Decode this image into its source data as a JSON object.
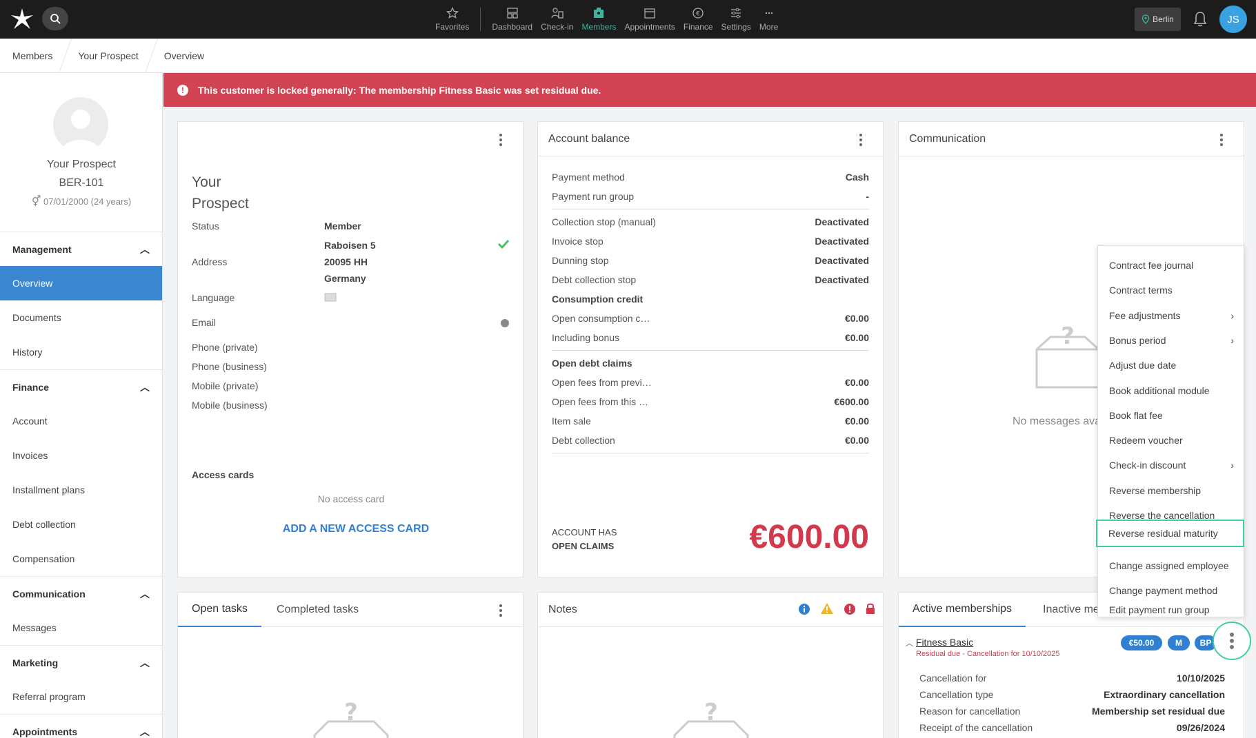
{
  "nav": {
    "items": [
      {
        "label": "Favorites",
        "icon": "star-icon"
      },
      {
        "label": "Dashboard",
        "icon": "dashboard-icon"
      },
      {
        "label": "Check-in",
        "icon": "checkin-icon"
      },
      {
        "label": "Members",
        "icon": "members-icon"
      },
      {
        "label": "Appointments",
        "icon": "calendar-icon"
      },
      {
        "label": "Finance",
        "icon": "euro-icon"
      },
      {
        "label": "Settings",
        "icon": "sliders-icon"
      },
      {
        "label": "More",
        "icon": "more-icon"
      }
    ],
    "active": "Members",
    "location": "Berlin",
    "user_initials": "JS",
    "accent": "#3bb4a0"
  },
  "breadcrumb": [
    "Members",
    "Your Prospect",
    "Overview"
  ],
  "alert": {
    "text": "This customer is locked generally: The membership Fitness Basic was set residual due.",
    "color": "#d24454"
  },
  "sidebar": {
    "profile": {
      "name": "Your Prospect",
      "id": "BER-101",
      "dob": "07/01/2000 (24 years)"
    },
    "sections": [
      {
        "title": "Management",
        "items": [
          "Overview",
          "Documents",
          "History"
        ]
      },
      {
        "title": "Finance",
        "items": [
          "Account",
          "Invoices",
          "Installment plans",
          "Debt collection",
          "Compensation"
        ]
      },
      {
        "title": "Communication",
        "items": [
          "Messages"
        ]
      },
      {
        "title": "Marketing",
        "items": [
          "Referral program"
        ]
      },
      {
        "title": "Appointments",
        "items": []
      }
    ],
    "active_item": "Overview"
  },
  "profile_card": {
    "name": "Your Prospect",
    "status_label": "Status",
    "status_value": "Member",
    "address_label": "Address",
    "address_lines": [
      "Raboisen 5",
      "20095 HH",
      "Germany"
    ],
    "language_label": "Language",
    "email_label": "Email",
    "phone_private_label": "Phone (private)",
    "phone_business_label": "Phone (business)",
    "mobile_private_label": "Mobile (private)",
    "mobile_business_label": "Mobile (business)",
    "access_cards_label": "Access cards",
    "no_access_card": "No access card",
    "add_access_card": "ADD A NEW ACCESS CARD"
  },
  "account_balance": {
    "title": "Account balance",
    "rows": [
      {
        "label": "Payment method",
        "value": "Cash"
      },
      {
        "label": "Payment run group",
        "value": "-"
      },
      {
        "label": "Collection stop (manual)",
        "value": "Deactivated"
      },
      {
        "label": "Invoice stop",
        "value": "Deactivated"
      },
      {
        "label": "Dunning stop",
        "value": "Deactivated"
      },
      {
        "label": "Debt collection stop",
        "value": "Deactivated"
      },
      {
        "label": "Open consumption c…",
        "value": "€0.00"
      },
      {
        "label": "Including bonus",
        "value": "€0.00"
      },
      {
        "label": "Open fees from previ…",
        "value": "€0.00"
      },
      {
        "label": "Open fees from this …",
        "value": "€600.00"
      },
      {
        "label": "Item sale",
        "value": "€0.00"
      },
      {
        "label": "Debt collection",
        "value": "€0.00"
      }
    ],
    "consumption_credit": "Consumption credit",
    "open_debt_claims": "Open debt claims",
    "footer_line1": "ACCOUNT HAS",
    "footer_line2": "OPEN CLAIMS",
    "total": "€600.00",
    "total_color": "#d03a4c"
  },
  "communication": {
    "title": "Communication",
    "empty": "No messages ava"
  },
  "menu": {
    "items": [
      {
        "label": "Contract fee journal",
        "sub": false
      },
      {
        "label": "Contract terms",
        "sub": false
      },
      {
        "label": "Fee adjustments",
        "sub": true
      },
      {
        "label": "Bonus period",
        "sub": true
      },
      {
        "label": "Adjust due date",
        "sub": false
      },
      {
        "label": "Book additional module",
        "sub": false
      },
      {
        "label": "Book flat fee",
        "sub": false
      },
      {
        "label": "Redeem voucher",
        "sub": false
      },
      {
        "label": "Check-in discount",
        "sub": true
      },
      {
        "label": "Reverse membership",
        "sub": false
      },
      {
        "label": "Reverse the cancellation",
        "sub": false
      },
      {
        "label": "Reverse residual maturity",
        "sub": false
      },
      {
        "label": "Change assigned employee",
        "sub": false
      },
      {
        "label": "Change payment method",
        "sub": false
      },
      {
        "label": "Edit payment run group",
        "sub": false
      }
    ],
    "highlighted": "Reverse residual maturity"
  },
  "tasks": {
    "tabs": [
      "Open tasks",
      "Completed tasks"
    ]
  },
  "notes": {
    "title": "Notes"
  },
  "memberships": {
    "tabs": [
      "Active memberships",
      "Inactive me"
    ],
    "name": "Fitness Basic",
    "subtitle": "Residual due - Cancellation for 10/10/2025",
    "pills": [
      "€50.00",
      "M",
      "BP"
    ],
    "rows": [
      {
        "label": "Cancellation for",
        "value": "10/10/2025"
      },
      {
        "label": "Cancellation type",
        "value": "Extraordinary cancellation"
      },
      {
        "label": "Reason for cancellation",
        "value": "Membership set residual due"
      },
      {
        "label": "Receipt of the cancellation",
        "value": "09/26/2024"
      }
    ]
  }
}
